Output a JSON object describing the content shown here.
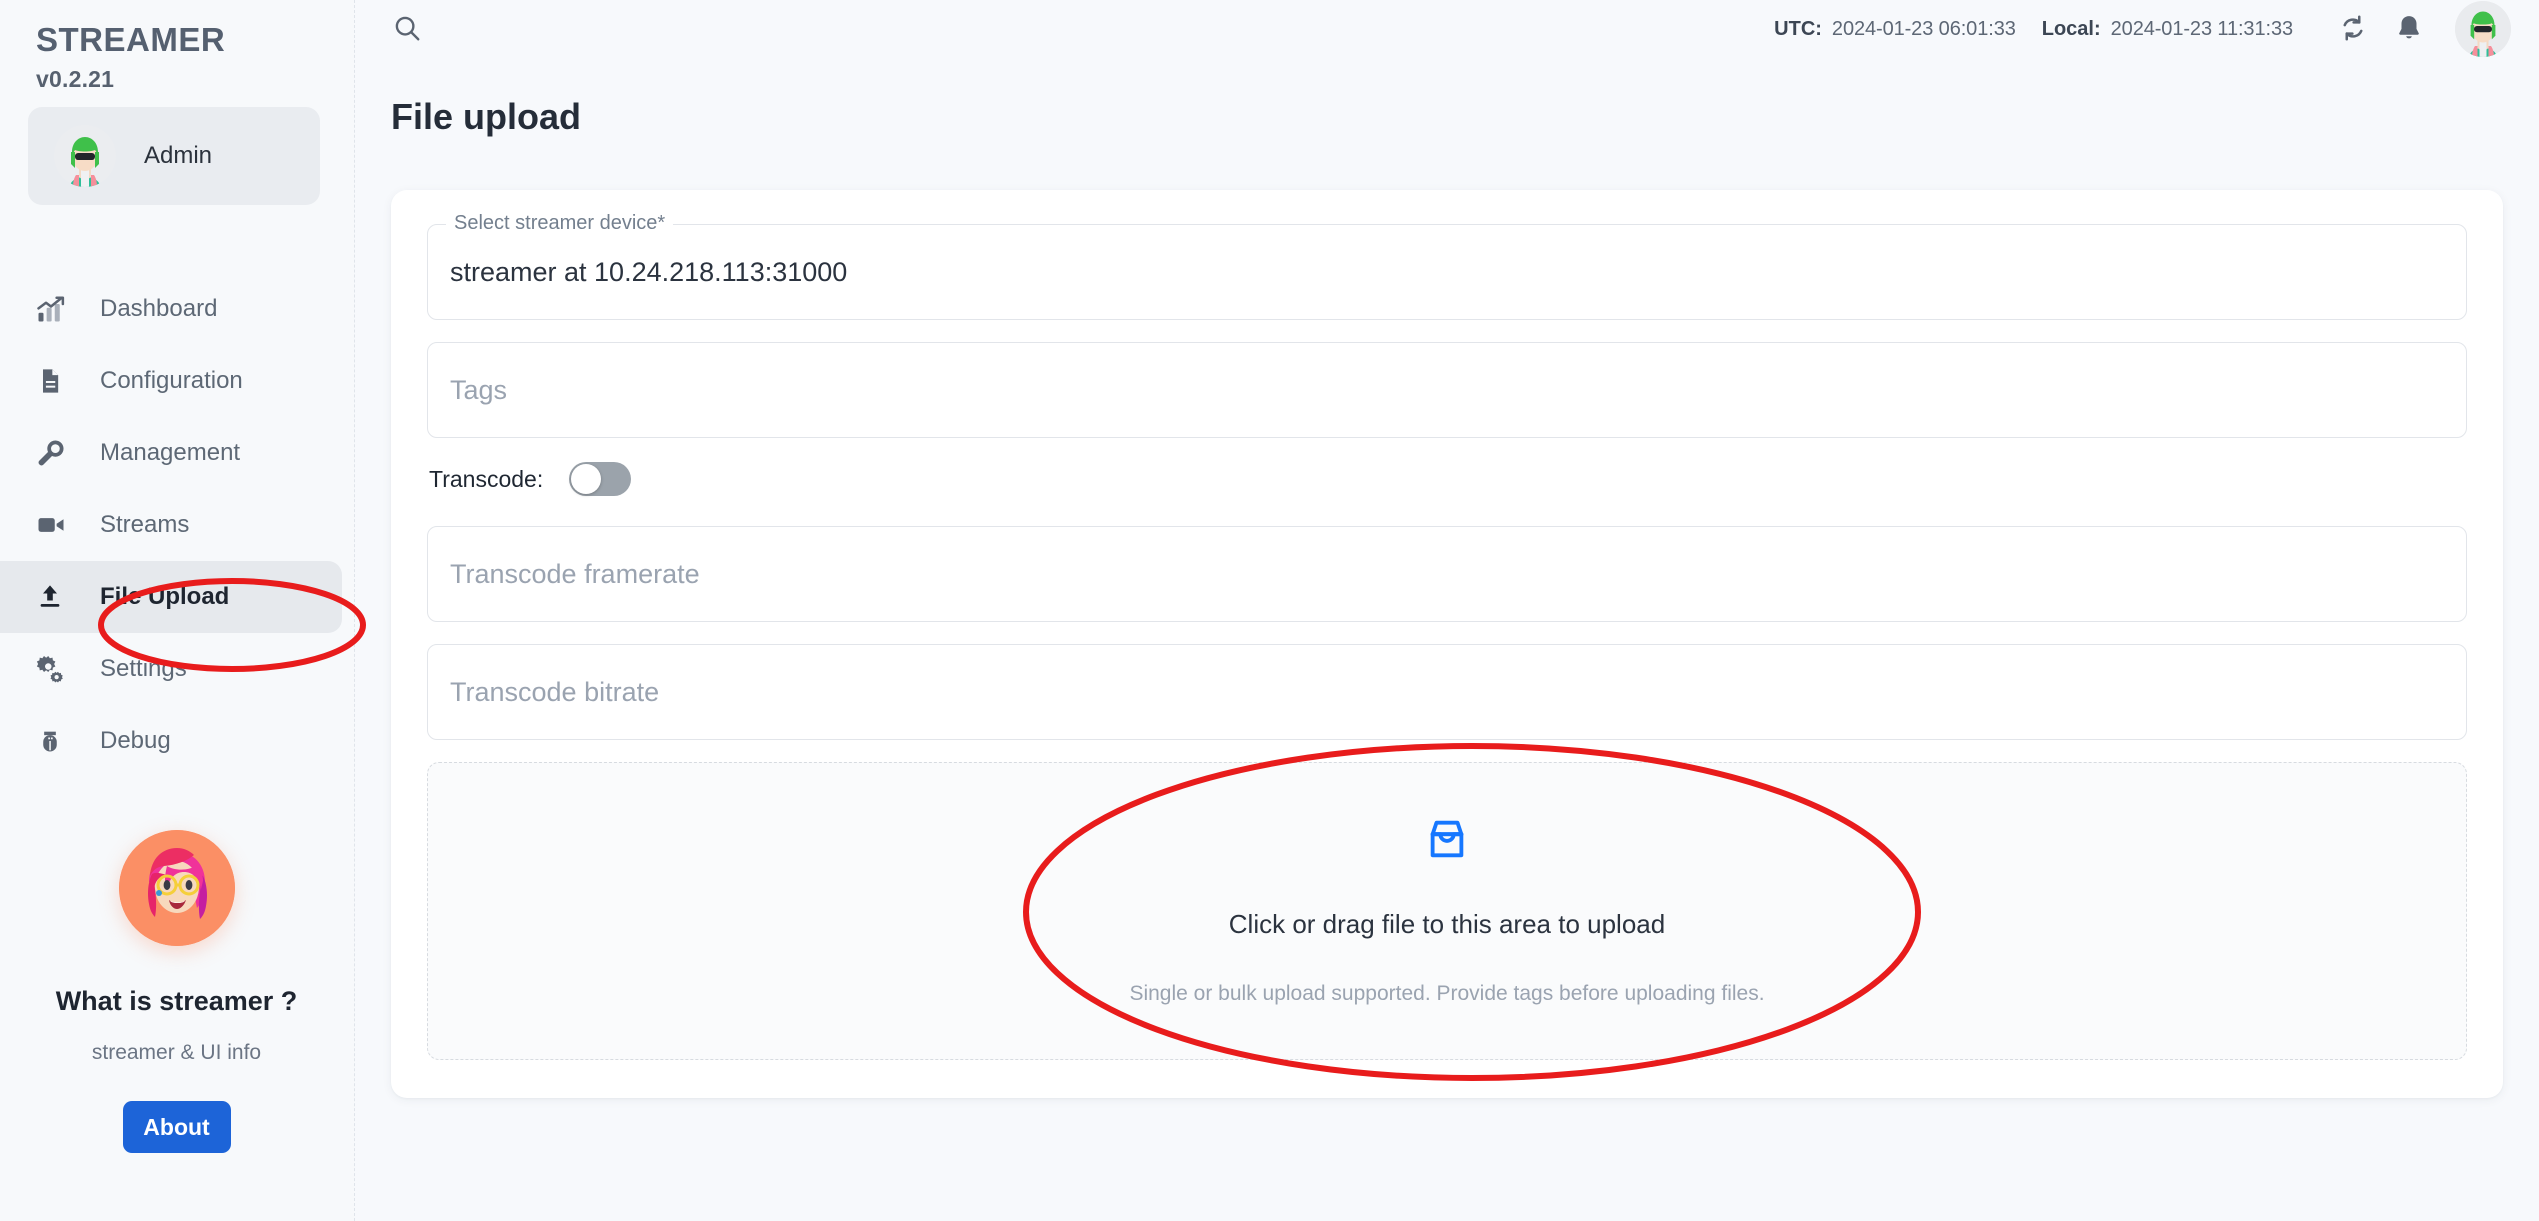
{
  "sidebar": {
    "brand_title": "STREAMER",
    "brand_version": "v0.2.21",
    "user_name": "Admin",
    "nav_items": [
      {
        "label": "Dashboard",
        "icon": "chart-bar-icon"
      },
      {
        "label": "Configuration",
        "icon": "document-icon"
      },
      {
        "label": "Management",
        "icon": "wrench-icon"
      },
      {
        "label": "Streams",
        "icon": "video-camera-icon"
      },
      {
        "label": "File Upload",
        "icon": "upload-icon"
      },
      {
        "label": "Settings",
        "icon": "gears-icon"
      },
      {
        "label": "Debug",
        "icon": "bug-icon"
      }
    ],
    "active_nav": "File Upload",
    "promo": {
      "title": "What is streamer ?",
      "subtitle": "streamer & UI info",
      "button_label": "About"
    }
  },
  "topbar": {
    "search_icon": "search-icon",
    "utc_label": "UTC:",
    "utc_value": "2024-01-23 06:01:33",
    "local_label": "Local:",
    "local_value": "2024-01-23 11:31:33",
    "refresh_icon": "refresh-sync-icon",
    "bell_icon": "notification-bell-icon",
    "avatar_icon": "user-avatar"
  },
  "page": {
    "title": "File upload"
  },
  "form": {
    "device": {
      "legend": "Select streamer device*",
      "value": "streamer at 10.24.218.113:31000"
    },
    "tags": {
      "placeholder": "Tags",
      "value": ""
    },
    "transcode": {
      "label": "Transcode:",
      "enabled": false
    },
    "framerate": {
      "placeholder": "Transcode framerate",
      "value": ""
    },
    "bitrate": {
      "placeholder": "Transcode bitrate",
      "value": ""
    },
    "dropzone": {
      "icon": "inbox-icon",
      "title": "Click or drag file to this area to upload",
      "hint": "Single or bulk upload supported. Provide tags before uploading files."
    }
  },
  "colors": {
    "accent_blue": "#1677ff",
    "button_blue": "#1d64d8",
    "annotation_red": "#e81c1c",
    "toggle_off": "#9ba3ab",
    "sidebar_bg": "#f7f9fb",
    "main_bg": "#f7f9fc"
  },
  "annotations": [
    {
      "name": "highlight-file-upload-nav",
      "shape": "ellipse",
      "color": "#e81c1c"
    },
    {
      "name": "highlight-upload-dropzone",
      "shape": "ellipse",
      "color": "#e81c1c"
    }
  ]
}
